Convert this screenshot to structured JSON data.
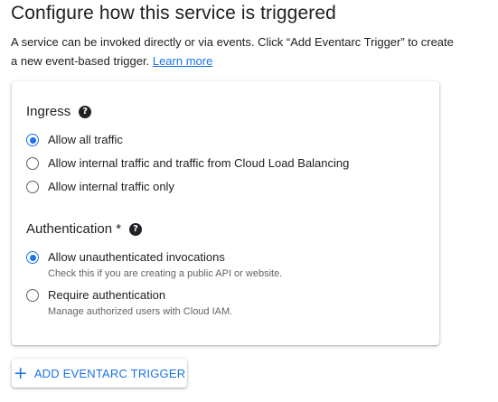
{
  "page": {
    "title": "Configure how this service is triggered",
    "description": "A service can be invoked directly or via events. Click “Add Eventarc Trigger” to create a new event-based trigger.",
    "learn_more": "Learn more"
  },
  "ingress": {
    "title": "Ingress",
    "help_icon": "help-circle-icon",
    "options": [
      {
        "label": "Allow all traffic",
        "selected": true
      },
      {
        "label": "Allow internal traffic and traffic from Cloud Load Balancing",
        "selected": false
      },
      {
        "label": "Allow internal traffic only",
        "selected": false
      }
    ]
  },
  "authentication": {
    "title": "Authentication *",
    "help_icon": "help-circle-icon",
    "options": [
      {
        "label": "Allow unauthenticated invocations",
        "help": "Check this if you are creating a public API or website.",
        "selected": true
      },
      {
        "label": "Require authentication",
        "help": "Manage authorized users with Cloud IAM.",
        "selected": false
      }
    ]
  },
  "add_trigger_button": {
    "label": "ADD EVENTARC TRIGGER",
    "icon": "plus-icon"
  },
  "colors": {
    "accent": "#1a73e8",
    "text": "#202124",
    "secondary_text": "#5f6368"
  }
}
